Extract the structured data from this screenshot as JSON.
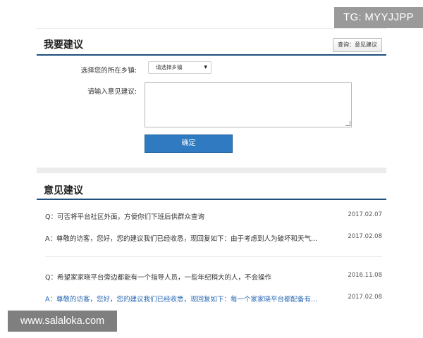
{
  "watermarks": {
    "top": "TG: MYYJJPP",
    "bottom": "www.salaloka.com"
  },
  "suggest_panel": {
    "title": "我要建议",
    "query_button": "查询：意见建议",
    "town_label": "选择您的所在乡镇:",
    "town_select_value": "请选择乡镇",
    "suggestion_label": "请输入意见建议:",
    "confirm_button": "确定"
  },
  "opinions_panel": {
    "title": "意见建议",
    "items": [
      {
        "question": "Q：可否将平台社区外面，方便你们下班后供群众查询",
        "question_date": "2017.02.07",
        "answer": "A：尊敬的访客，您好，您的建议我们已经收悉，现回复如下：由于考虑到人为破坏和天气...",
        "answer_date": "2017.02.08"
      },
      {
        "question": "Q：希望家家晓平台旁边都能有一个指导人员，一些年纪稍大的人，不会操作",
        "question_date": "2016.11.08",
        "answer": "A：尊敬的访客，您好，您的建议我们已经收悉，现回复如下：每一个家家晓平台都配备有...",
        "answer_date": "2017.02.08"
      }
    ]
  },
  "colors": {
    "accent": "#1f4f7c",
    "button": "#2f7ac0",
    "link_answer": "#2a69b4"
  }
}
